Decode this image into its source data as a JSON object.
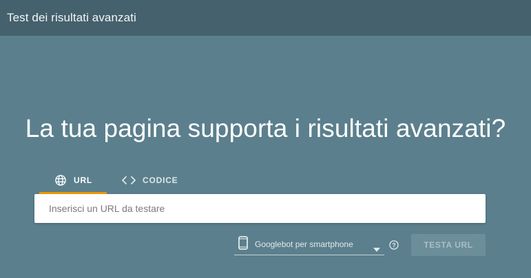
{
  "app": {
    "title": "Test dei risultati avanzati"
  },
  "main": {
    "headline": "La tua pagina supporta i risultati avanzati?"
  },
  "tabs": [
    {
      "label": "URL",
      "icon": "globe-icon",
      "active": true
    },
    {
      "label": "CODICE",
      "icon": "code-brackets-icon",
      "active": false
    }
  ],
  "url_input": {
    "placeholder": "Inserisci un URL da testare",
    "value": ""
  },
  "device_select": {
    "selected": "Googlebot per smartphone",
    "icon": "smartphone-icon"
  },
  "help": {
    "icon": "help-circle-icon"
  },
  "test_button": {
    "label": "TESTA URL",
    "enabled": false
  },
  "colors": {
    "background": "#5b7f8d",
    "appbar": "#45616d",
    "tab_indicator": "#f29900",
    "button_disabled_bg": "#6c8e9b",
    "button_disabled_text": "#a9bec6"
  }
}
